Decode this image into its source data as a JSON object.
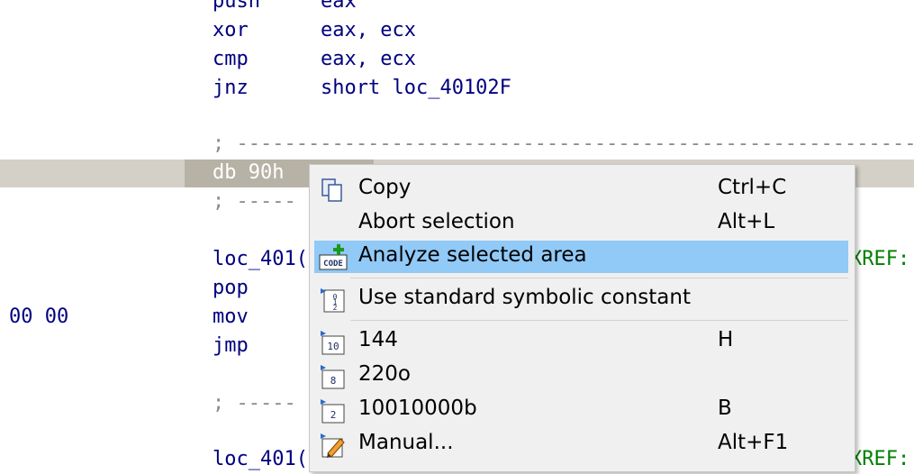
{
  "disasm": {
    "lines": [
      {
        "mnemonic": "push",
        "operand": "eax"
      },
      {
        "mnemonic": "xor",
        "operand": "eax, ecx"
      },
      {
        "mnemonic": "cmp",
        "operand": "eax, ecx"
      },
      {
        "mnemonic": "jnz",
        "operand": "short loc_40102F"
      }
    ],
    "sep1": "; -----------------------------------------------------------",
    "selected_line": "db 90h",
    "sep2": "; -----",
    "loc1": "loc_401(",
    "xref1": "XREF:",
    "pop": "pop",
    "mov": "mov",
    "jmp": "jmp",
    "left_bytes": "00 00",
    "sep3": "; -----",
    "loc2": "loc_401(",
    "xref2": "XREF:"
  },
  "context_menu": {
    "items": [
      {
        "label": "Copy",
        "shortcut": "Ctrl+C",
        "icon": "copy-icon"
      },
      {
        "label": "Abort selection",
        "shortcut": "Alt+L",
        "icon": ""
      },
      {
        "label": "Analyze selected area",
        "shortcut": "",
        "icon": "code-analyze-icon",
        "icon_text": "CODE"
      },
      {
        "label": "Use standard symbolic constant",
        "shortcut": "",
        "icon": "symbolic-constant-icon"
      },
      {
        "label": "144",
        "shortcut": "H",
        "icon": "decimal-icon",
        "icon_text": "10"
      },
      {
        "label": "220o",
        "shortcut": "",
        "icon": "octal-icon",
        "icon_text": "8"
      },
      {
        "label": "10010000b",
        "shortcut": "B",
        "icon": "binary-icon",
        "icon_text": "2"
      },
      {
        "label": "Manual...",
        "shortcut": "Alt+F1",
        "icon": "manual-edit-icon"
      }
    ],
    "highlight_color": "#91c9f7"
  }
}
